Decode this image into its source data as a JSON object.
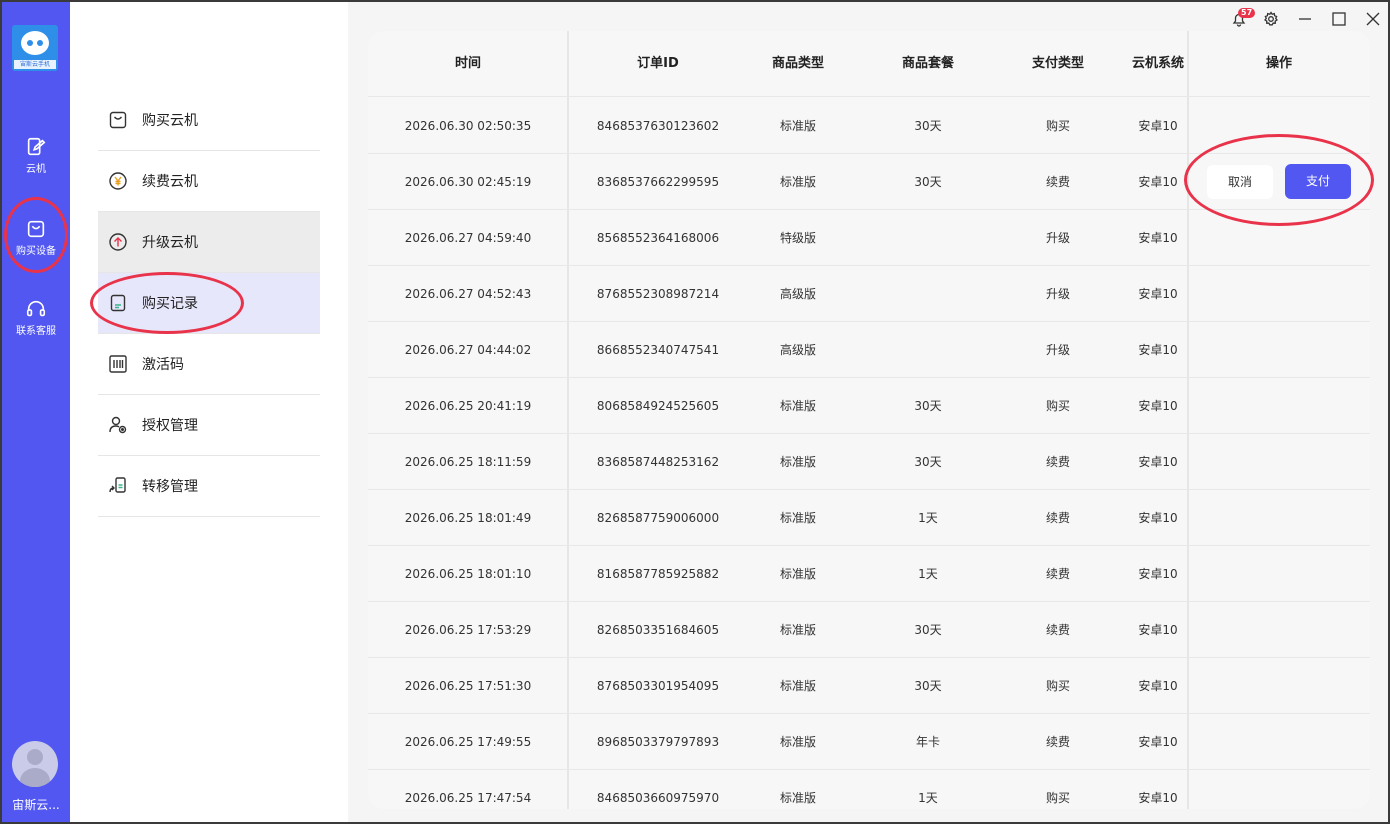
{
  "rail": {
    "logo_text": "宙斯云手机",
    "items": [
      {
        "label": "云机",
        "icon": "cloud-phone-icon"
      },
      {
        "label": "购买设备",
        "icon": "shopping-bag-icon"
      },
      {
        "label": "联系客服",
        "icon": "headset-icon"
      }
    ],
    "user_name": "宙斯云..."
  },
  "menu": {
    "items": [
      {
        "label": "购买云机",
        "icon": "bag-icon"
      },
      {
        "label": "续费云机",
        "icon": "yen-circle-icon"
      },
      {
        "label": "升级云机",
        "icon": "arrow-up-circle-icon"
      },
      {
        "label": "购买记录",
        "icon": "document-icon"
      },
      {
        "label": "激活码",
        "icon": "barcode-icon"
      },
      {
        "label": "授权管理",
        "icon": "user-lock-icon"
      },
      {
        "label": "转移管理",
        "icon": "transfer-phone-icon"
      }
    ]
  },
  "topbar": {
    "badge_count": "57"
  },
  "table": {
    "headers": [
      "时间",
      "订单ID",
      "商品类型",
      "商品套餐",
      "支付类型",
      "云机系统",
      "操作"
    ],
    "rows": [
      [
        "2026.06.30 02:50:35",
        "8468537630123602",
        "标准版",
        "30天",
        "购买",
        "安卓10"
      ],
      [
        "2026.06.30 02:45:19",
        "8368537662299595",
        "标准版",
        "30天",
        "续费",
        "安卓10"
      ],
      [
        "2026.06.27 04:59:40",
        "8568552364168006",
        "特级版",
        "",
        "升级",
        "安卓10"
      ],
      [
        "2026.06.27 04:52:43",
        "8768552308987214",
        "高级版",
        "",
        "升级",
        "安卓10"
      ],
      [
        "2026.06.27 04:44:02",
        "8668552340747541",
        "高级版",
        "",
        "升级",
        "安卓10"
      ],
      [
        "2026.06.25 20:41:19",
        "8068584924525605",
        "标准版",
        "30天",
        "购买",
        "安卓10"
      ],
      [
        "2026.06.25 18:11:59",
        "8368587448253162",
        "标准版",
        "30天",
        "续费",
        "安卓10"
      ],
      [
        "2026.06.25 18:01:49",
        "8268587759006000",
        "标准版",
        "1天",
        "续费",
        "安卓10"
      ],
      [
        "2026.06.25 18:01:10",
        "8168587785925882",
        "标准版",
        "1天",
        "续费",
        "安卓10"
      ],
      [
        "2026.06.25 17:53:29",
        "8268503351684605",
        "标准版",
        "30天",
        "续费",
        "安卓10"
      ],
      [
        "2026.06.25 17:51:30",
        "8768503301954095",
        "标准版",
        "30天",
        "购买",
        "安卓10"
      ],
      [
        "2026.06.25 17:49:55",
        "8968503379797893",
        "标准版",
        "年卡",
        "续费",
        "安卓10"
      ],
      [
        "2026.06.25 17:47:54",
        "8468503660975970",
        "标准版",
        "1天",
        "购买",
        "安卓10"
      ]
    ],
    "actions": {
      "cancel_label": "取消",
      "pay_label": "支付"
    }
  },
  "colors": {
    "accent": "#5157f0",
    "highlight_circle": "#e8334a"
  }
}
